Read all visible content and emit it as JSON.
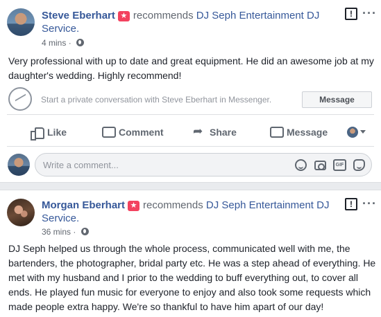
{
  "post1": {
    "author": "Steve Eberhart",
    "recommends_text": "recommends",
    "page_name_line1": "DJ Seph Entertainment DJ",
    "page_name_line2": "Service.",
    "timestamp": "4 mins",
    "body": "Very professional with up to date and great equipment. He did an awesome job at my daughter's wedding. Highly recommend!",
    "messenger_prompt": "Start a private conversation with Steve Eberhart in Messenger.",
    "message_button": "Message"
  },
  "actions": {
    "like": "Like",
    "comment": "Comment",
    "share": "Share",
    "message": "Message"
  },
  "comment_box": {
    "placeholder": "Write a comment...",
    "gif_label": "GIF"
  },
  "post2": {
    "author": "Morgan Eberhart",
    "recommends_text": "recommends",
    "page_name_line1": "DJ Seph Entertainment DJ",
    "page_name_line2": "Service.",
    "timestamp": "36 mins",
    "body": "DJ Seph helped us through the whole process, communicated well with me, the bartenders, the photographer, bridal party etc. He was a step ahead of everything. He met with my husband and I prior to the wedding to buff everything out, to cover all ends. He played fun music for everyone to enjoy and also took some requests which made people extra happy. We're so thankful to have him apart of our day!"
  },
  "icons": {
    "recommendation_badge": "star-icon",
    "audience": "globe-icon",
    "report": "exclamation-icon",
    "more": "ellipsis-icon"
  },
  "colors": {
    "link": "#365899",
    "badge": "#f3425f",
    "secondary_text": "#616770",
    "background": "#e9ebee"
  }
}
